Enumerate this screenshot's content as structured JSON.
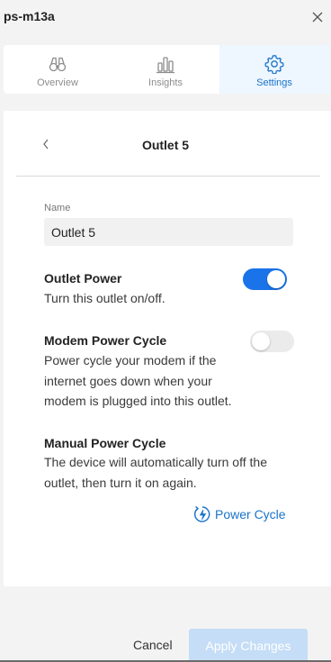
{
  "window": {
    "title": "ps-m13a"
  },
  "tabs": [
    {
      "label": "Overview",
      "icon": "binoculars-icon",
      "active": false
    },
    {
      "label": "Insights",
      "icon": "bar-chart-icon",
      "active": false
    },
    {
      "label": "Settings",
      "icon": "gear-icon",
      "active": true
    }
  ],
  "panel": {
    "title": "Outlet 5",
    "name_label": "Name",
    "name_value": "Outlet 5",
    "outlet_power": {
      "title": "Outlet Power",
      "desc": "Turn this outlet on/off.",
      "enabled": true
    },
    "modem_power_cycle": {
      "title": "Modem Power Cycle",
      "desc": "Power cycle your modem if the internet goes down when your modem is plugged into this outlet.",
      "enabled": false
    },
    "manual_power_cycle": {
      "title": "Manual Power Cycle",
      "desc": "The device will automatically turn off the outlet, then turn it on again.",
      "button": "Power Cycle"
    }
  },
  "footer": {
    "cancel": "Cancel",
    "apply": "Apply Changes"
  },
  "colors": {
    "accent": "#1a73e8",
    "tab_active_bg": "#eef6ff",
    "apply_disabled": "#c5ddf6"
  }
}
